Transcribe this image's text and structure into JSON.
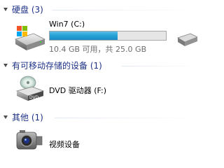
{
  "groups": [
    {
      "title": "硬盘 (3)"
    },
    {
      "title": "有可移动存储的设备 (1)"
    },
    {
      "title": "其他 (1)"
    }
  ],
  "hard_disks": [
    {
      "name": "Win7 (C:)",
      "free_text": "10.4 GB 可用，共 25.0 GB",
      "used_fraction": 0.584,
      "icon": "hard-drive-icon"
    }
  ],
  "removable": [
    {
      "name": "DVD 驱动器 (F:)",
      "icon": "dvd-drive-icon",
      "icon_text": "DVD"
    }
  ],
  "other": [
    {
      "name": "视频设备",
      "icon": "video-device-icon"
    }
  ],
  "colors": {
    "group_title": "#1e3287",
    "bar_fill": "#28a2d6"
  }
}
